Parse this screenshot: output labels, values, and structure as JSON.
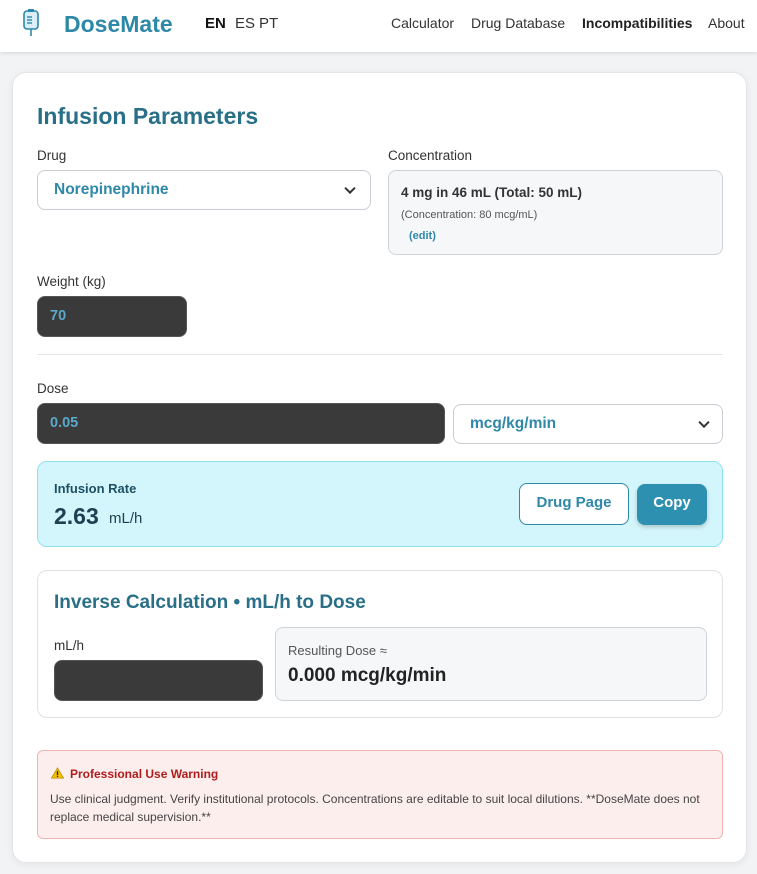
{
  "brand": {
    "name": "DoseMate",
    "icon": "iv-bag-icon"
  },
  "languages": [
    {
      "code": "EN",
      "active": true
    },
    {
      "code": "ES",
      "active": false
    },
    {
      "code": "PT",
      "active": false
    }
  ],
  "nav": {
    "calculator": "Calculator",
    "drug_database": "Drug Database",
    "incompatibilities": "Incompatibilities",
    "about": "About"
  },
  "params": {
    "title": "Infusion Parameters",
    "drug_label": "Drug",
    "drug_value": "Norepinephrine",
    "concentration_label": "Concentration",
    "concentration_main": "4 mg in 46 mL (Total: 50 mL)",
    "concentration_sub": "(Concentration: 80 mcg/mL)",
    "concentration_edit": "(edit)",
    "weight_label": "Weight (kg)",
    "weight_value": "70",
    "dose_label": "Dose",
    "dose_value": "0.05",
    "dose_unit": "mcg/kg/min"
  },
  "rate": {
    "label": "Infusion Rate",
    "value": "2.63",
    "unit": "mL/h",
    "drug_page_button": "Drug Page",
    "copy_button": "Copy"
  },
  "inverse": {
    "title": "Inverse Calculation • mL/h to Dose",
    "mlh_label": "mL/h",
    "mlh_value": "",
    "result_label": "Resulting Dose ≈",
    "result_value": "0.000 mcg/kg/min"
  },
  "warning": {
    "icon": "warning-triangle-icon",
    "title": "Professional Use Warning",
    "text": "Use clinical judgment. Verify institutional protocols. Concentrations are editable to suit local dilutions. **DoseMate does not replace medical supervision.**"
  },
  "colors": {
    "brand": "#2e88a8",
    "title": "#2a6f88",
    "rate_bg": "#d2f6fb",
    "warning_bg": "#fdeeee",
    "warning_text": "#b01c1c"
  }
}
